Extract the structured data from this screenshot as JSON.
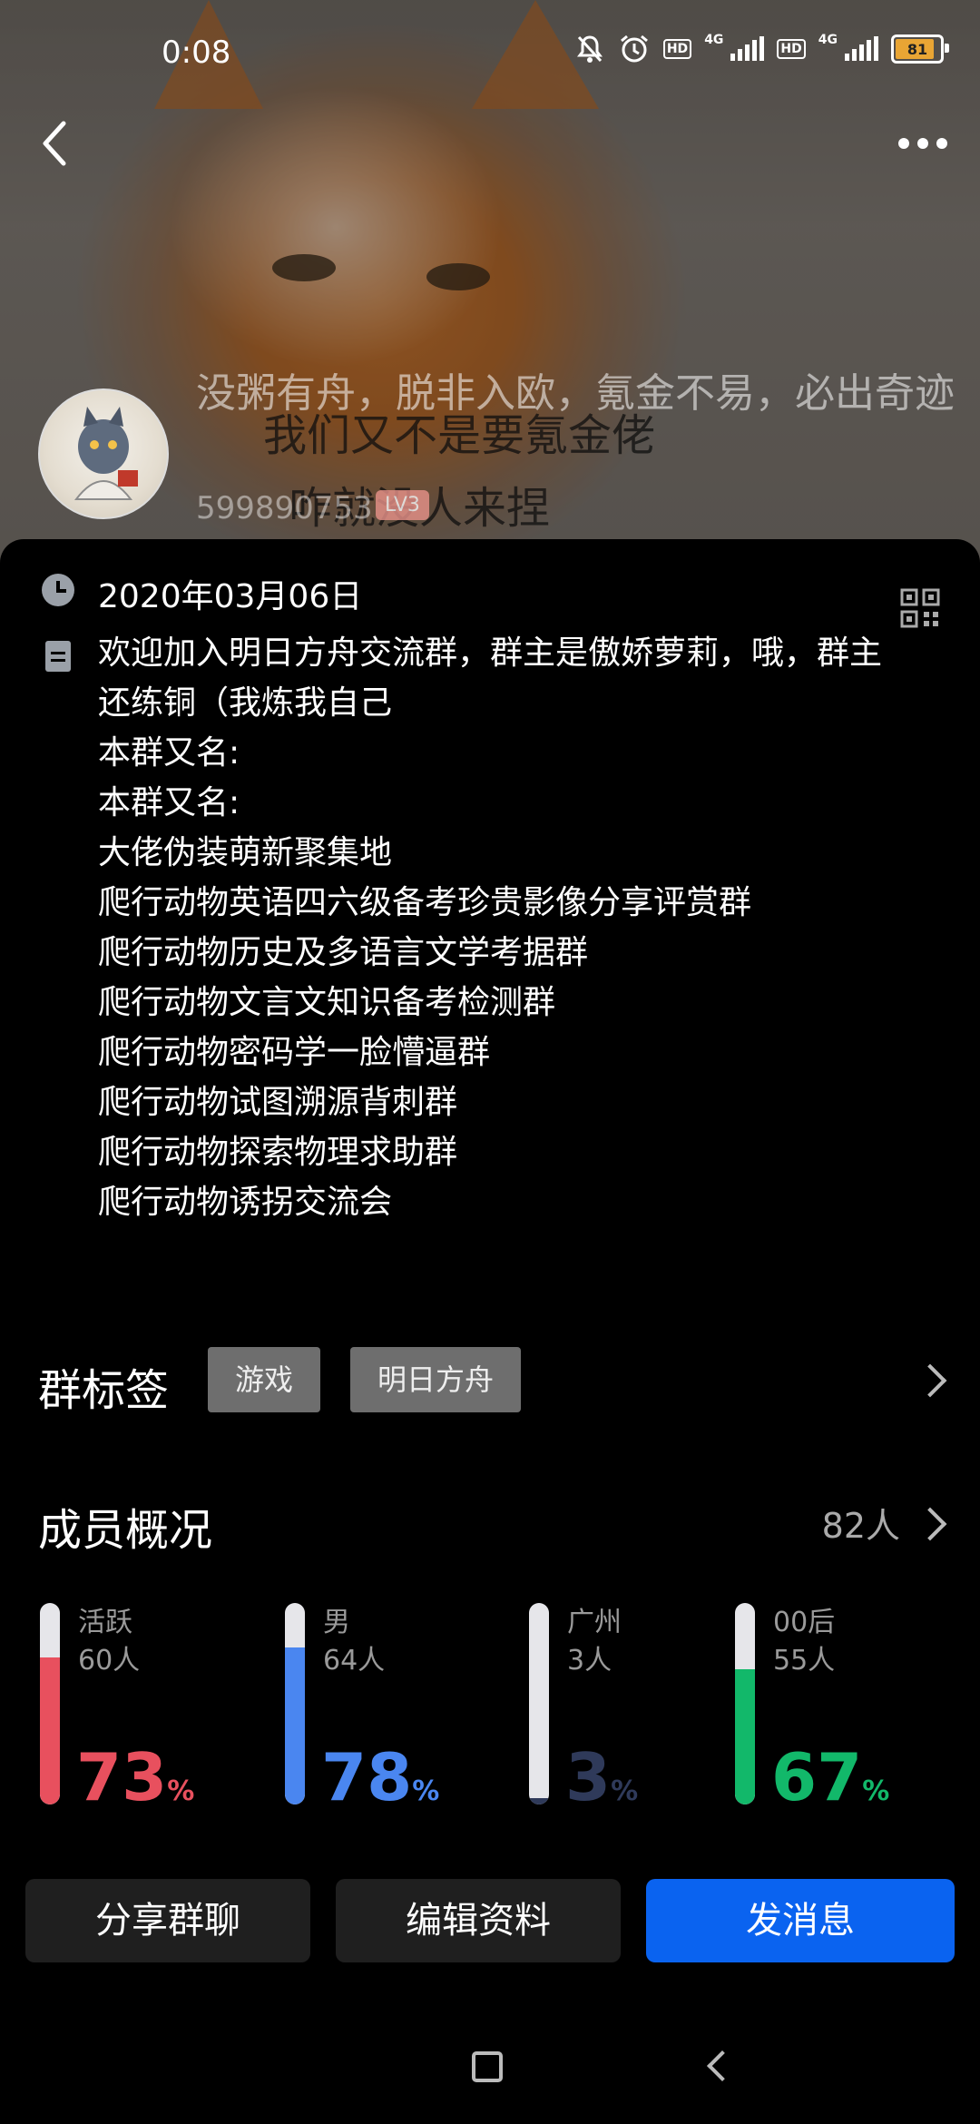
{
  "status_bar": {
    "time": "0:08",
    "signal_label": "4G",
    "hd_label": "HD",
    "battery_level": "81"
  },
  "hero": {
    "meme_line1": "我们又不是要氪金佬",
    "meme_line2": "咋就没人来捏"
  },
  "group": {
    "name": "没粥有舟，脱非入欧，氪金不易，必出奇迹",
    "id": "599890753",
    "level": "LV3"
  },
  "info": {
    "date": "2020年03月06日",
    "description_lines": [
      "欢迎加入明日方舟交流群，群主是傲娇萝莉，哦，群主",
      "还练铜（我炼我自己",
      "本群又名:",
      "本群又名:",
      "大佬伪装萌新聚集地",
      "爬行动物英语四六级备考珍贵影像分享评赏群",
      "爬行动物历史及多语言文学考据群",
      "爬行动物文言文知识备考检测群",
      "爬行动物密码学一脸懵逼群",
      "爬行动物试图溯源背刺群",
      "爬行动物探索物理求助群",
      "爬行动物诱拐交流会"
    ]
  },
  "tags": {
    "title": "群标签",
    "items": [
      "游戏",
      "明日方舟"
    ]
  },
  "members": {
    "title": "成员概况",
    "count": "82人",
    "stats": [
      {
        "label": "活跃",
        "count": "60人",
        "percent": "73",
        "unit": "%",
        "color": "#e8505e",
        "fill": 0.73
      },
      {
        "label": "男",
        "count": "64人",
        "percent": "78",
        "unit": "%",
        "color": "#4a86f0",
        "fill": 0.78
      },
      {
        "label": "广州",
        "count": "3人",
        "percent": "3",
        "unit": "%",
        "color": "#2f3a5a",
        "fill": 0.03
      },
      {
        "label": "00后",
        "count": "55人",
        "percent": "67",
        "unit": "%",
        "color": "#12b86a",
        "fill": 0.67
      }
    ]
  },
  "actions": {
    "share": "分享群聊",
    "edit": "编辑资料",
    "message": "发消息"
  },
  "colors": {
    "primary_button": "#0a63f0",
    "level_badge": "#e8928a"
  }
}
